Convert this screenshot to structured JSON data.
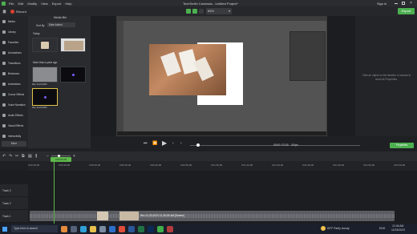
{
  "title_bar": {
    "menus": [
      "File",
      "Edit",
      "Modify",
      "View",
      "Export",
      "Help"
    ],
    "title": "TechSmith Camtasia - Untitled Project*",
    "signin": "Sign in",
    "window_controls": [
      "minimize-icon",
      "maximize-icon",
      "close-icon"
    ]
  },
  "toolbar": {
    "record_label": "Record",
    "zoom_value": "66%",
    "export_label": "Export"
  },
  "left_nav": {
    "items": [
      {
        "label": "Media",
        "icon": "media-icon"
      },
      {
        "label": "Library",
        "icon": "library-icon"
      },
      {
        "label": "Favorites",
        "icon": "star-icon"
      },
      {
        "label": "Annotations",
        "icon": "annotation-icon"
      },
      {
        "label": "Transitions",
        "icon": "transition-icon"
      },
      {
        "label": "Behaviors",
        "icon": "behavior-icon"
      },
      {
        "label": "Animations",
        "icon": "animation-icon"
      },
      {
        "label": "Cursor Effects",
        "icon": "cursor-icon"
      },
      {
        "label": "Voice Narration",
        "icon": "mic-icon"
      },
      {
        "label": "Audio Effects",
        "icon": "audio-icon"
      },
      {
        "label": "Visual Effects",
        "icon": "visual-icon"
      },
      {
        "label": "Interactivity",
        "icon": "interactivity-icon"
      }
    ],
    "more_label": "More"
  },
  "media_bin": {
    "title": "Media Bin",
    "sort_label": "Sort By",
    "sort_value": "Date Added",
    "groups": [
      {
        "label": "Today",
        "items": [
          {
            "caption": "Rec 11-23-2023"
          }
        ]
      },
      {
        "label": "More than a year ago",
        "items": [
          {
            "caption": "Rec 11-23-2023"
          },
          {
            "caption": "Rec 11-23-2023"
          },
          {
            "caption": "Rec 11-23-2023"
          }
        ]
      }
    ]
  },
  "properties": {
    "hint": "Click an object on the timeline or canvas to show its Properties."
  },
  "transport": {
    "time": "00:00 / 07:00",
    "fps": "30 fps",
    "properties_button": "Properties"
  },
  "timeline": {
    "playhead_time": "0:00:00;00",
    "ruler_ticks": [
      "0:00:00;00",
      "0:00:10;00",
      "0:00:20;00",
      "0:00:30;00",
      "0:00:40;00",
      "0:00:50;00",
      "0:01:00;00",
      "0:01:10;00",
      "0:01:20;00",
      "0:01:30;00",
      "0:01:40;00",
      "0:01:50;00",
      "0:02:00;00"
    ],
    "tracks": [
      "Track 3",
      "Track 2",
      "Track 1"
    ],
    "clip_label": "Rec 11-23-2023 12-28-29-AM [Screen]"
  },
  "taskbar": {
    "search_placeholder": "Type here to search",
    "weather": "80°F  Partly cloudy",
    "lang": "ENG",
    "time": "12:46 AM",
    "date": "11/23/2023"
  },
  "colors": {
    "record": "#e2402f",
    "export": "#4caf50",
    "accent": "#5fb84b"
  }
}
